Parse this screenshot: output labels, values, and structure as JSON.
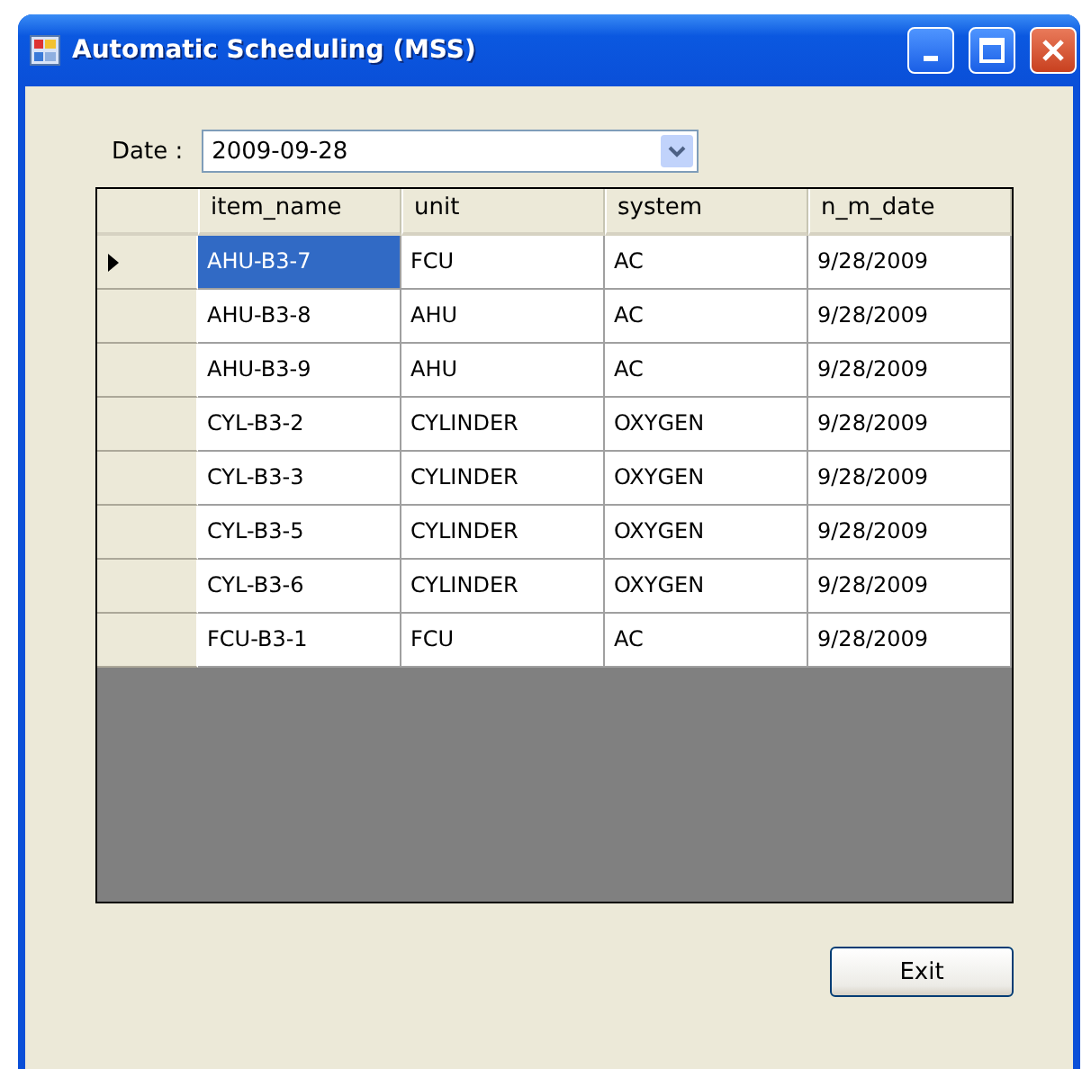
{
  "window": {
    "title": "Automatic Scheduling (MSS)"
  },
  "date": {
    "label": "Date :",
    "value": "2009-09-28"
  },
  "grid": {
    "columns": [
      "item_name",
      "unit",
      "system",
      "n_m_date"
    ],
    "rows": [
      {
        "current": true,
        "cells": [
          {
            "text": "AHU-B3-7",
            "selected": true
          },
          {
            "text": "FCU",
            "selected": false
          },
          {
            "text": "AC",
            "selected": false
          },
          {
            "text": "9/28/2009",
            "selected": false
          }
        ]
      },
      {
        "current": false,
        "cells": [
          {
            "text": "AHU-B3-8",
            "selected": false
          },
          {
            "text": "AHU",
            "selected": false
          },
          {
            "text": "AC",
            "selected": false
          },
          {
            "text": "9/28/2009",
            "selected": false
          }
        ]
      },
      {
        "current": false,
        "cells": [
          {
            "text": "AHU-B3-9",
            "selected": false
          },
          {
            "text": "AHU",
            "selected": false
          },
          {
            "text": "AC",
            "selected": false
          },
          {
            "text": "9/28/2009",
            "selected": false
          }
        ]
      },
      {
        "current": false,
        "cells": [
          {
            "text": "CYL-B3-2",
            "selected": false
          },
          {
            "text": "CYLINDER",
            "selected": false
          },
          {
            "text": "OXYGEN",
            "selected": false
          },
          {
            "text": "9/28/2009",
            "selected": false
          }
        ]
      },
      {
        "current": false,
        "cells": [
          {
            "text": "CYL-B3-3",
            "selected": false
          },
          {
            "text": "CYLINDER",
            "selected": false
          },
          {
            "text": "OXYGEN",
            "selected": false
          },
          {
            "text": "9/28/2009",
            "selected": false
          }
        ]
      },
      {
        "current": false,
        "cells": [
          {
            "text": "CYL-B3-5",
            "selected": false
          },
          {
            "text": "CYLINDER",
            "selected": false
          },
          {
            "text": "OXYGEN",
            "selected": false
          },
          {
            "text": "9/28/2009",
            "selected": false
          }
        ]
      },
      {
        "current": false,
        "cells": [
          {
            "text": "CYL-B3-6",
            "selected": false
          },
          {
            "text": "CYLINDER",
            "selected": false
          },
          {
            "text": "OXYGEN",
            "selected": false
          },
          {
            "text": "9/28/2009",
            "selected": false
          }
        ]
      },
      {
        "current": false,
        "cells": [
          {
            "text": "FCU-B3-1",
            "selected": false
          },
          {
            "text": "FCU",
            "selected": false
          },
          {
            "text": "AC",
            "selected": false
          },
          {
            "text": "9/28/2009",
            "selected": false
          }
        ]
      }
    ]
  },
  "buttons": [
    "Exit"
  ]
}
